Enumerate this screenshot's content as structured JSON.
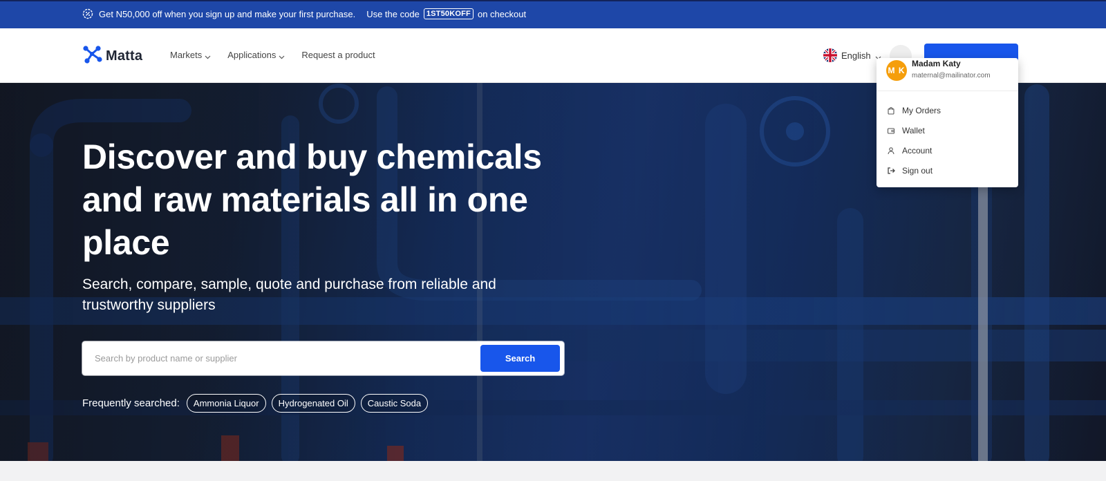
{
  "promo": {
    "text": "Get N50,000 off when you sign up and make your first purchase.",
    "code_prefix": "Use the code",
    "code": "1ST50KOFF",
    "code_suffix": "on checkout"
  },
  "header": {
    "logo_text": "Matta",
    "nav": [
      {
        "label": "Markets"
      },
      {
        "label": "Applications"
      },
      {
        "label": "Request a product"
      }
    ],
    "language": "English"
  },
  "hero": {
    "title": "Discover and buy chemicals and raw materials all in one place",
    "subtitle": "Search, compare, sample, quote and purchase from reliable and trustworthy suppliers",
    "search": {
      "placeholder": "Search by product name or supplier",
      "button_label": "Search"
    },
    "frequent": {
      "label": "Frequently searched:",
      "chips": [
        "Ammonia Liquor",
        "Hydrogenated Oil",
        "Caustic Soda"
      ]
    }
  },
  "user_menu": {
    "initials": "M K",
    "name": "Madam Katy",
    "email": "maternal@mailinator.com",
    "items": [
      {
        "label": "My Orders",
        "icon": "bag-icon"
      },
      {
        "label": "Wallet",
        "icon": "wallet-icon"
      },
      {
        "label": "Account",
        "icon": "user-icon"
      },
      {
        "label": "Sign out",
        "icon": "sign-out-icon"
      }
    ],
    "avatar_color": "#f59e0b"
  },
  "colors": {
    "brand_blue": "#1856eb",
    "promo_bg": "#1e47a8"
  }
}
